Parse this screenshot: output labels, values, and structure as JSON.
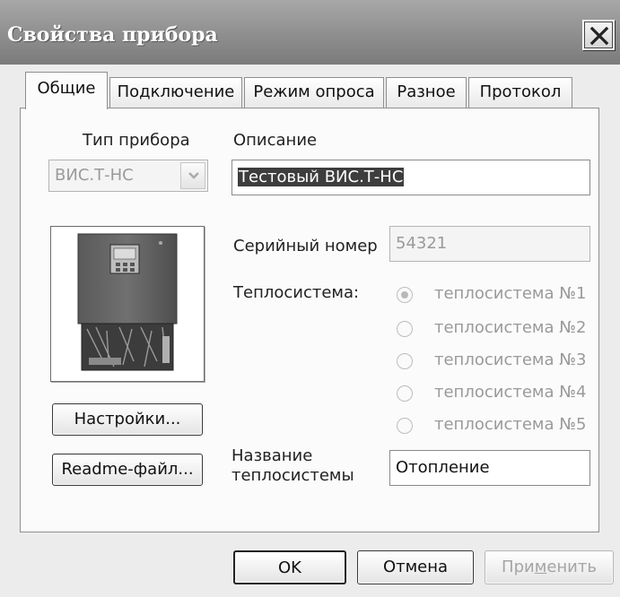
{
  "window": {
    "title": "Свойства прибора"
  },
  "tabs": [
    {
      "label": "Общие",
      "active": true
    },
    {
      "label": "Подключение",
      "active": false
    },
    {
      "label": "Режим опроса",
      "active": false
    },
    {
      "label": "Разное",
      "active": false
    },
    {
      "label": "Протокол",
      "active": false
    }
  ],
  "general": {
    "device_type_label": "Тип прибора",
    "device_type_value": "ВИС.Т-НС",
    "description_label": "Описание",
    "description_value": "Тестовый ВИС.Т-НС",
    "serial_label": "Серийный номер",
    "serial_value": "54321",
    "heat_system_label": "Теплосистема:",
    "heat_systems": [
      {
        "label": "теплосистема №1",
        "selected": true
      },
      {
        "label": "теплосистема №2",
        "selected": false
      },
      {
        "label": "теплосистема №3",
        "selected": false
      },
      {
        "label": "теплосистема №4",
        "selected": false
      },
      {
        "label": "теплосистема №5",
        "selected": false
      }
    ],
    "system_name_label_line1": "Название",
    "system_name_label_line2": "теплосистемы",
    "system_name_value": "Отопление",
    "settings_button": "Настройки...",
    "readme_button": "Readme-файл..."
  },
  "footer": {
    "ok": "OK",
    "cancel": "Отмена",
    "apply_prefix": "При",
    "apply_mnemonic": "м",
    "apply_suffix": "енить"
  },
  "icons": {
    "close": "close-icon",
    "combo": "chevron-down-icon",
    "device": "device-image"
  },
  "colors": {
    "titlebar": "#8e8e8e",
    "dialog_bg": "#ececec",
    "selection": "#3d3d3d",
    "disabled_text": "#9a9a9a"
  }
}
